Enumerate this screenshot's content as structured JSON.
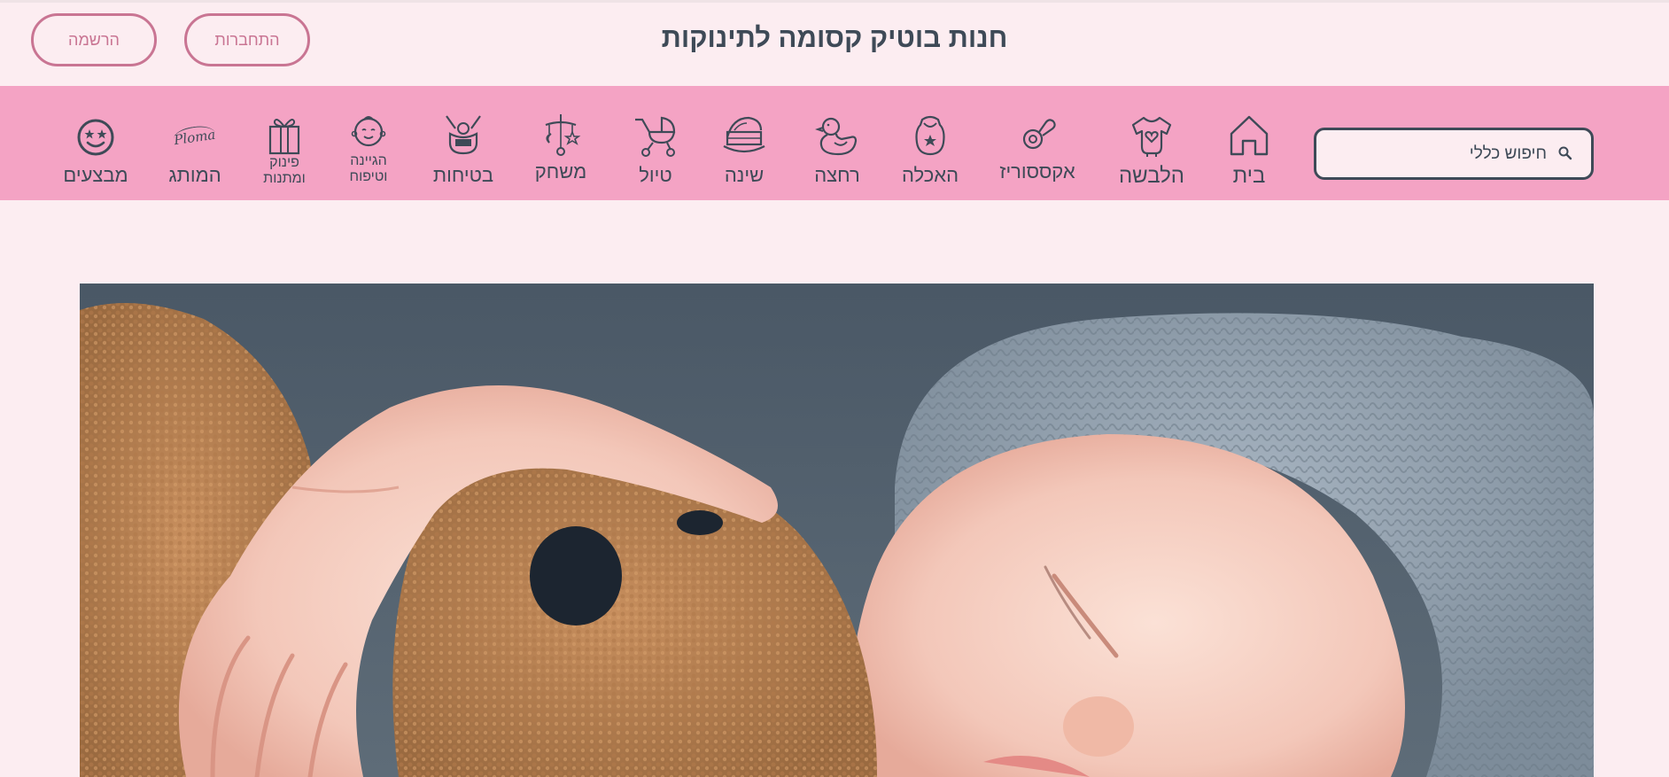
{
  "header": {
    "site_title": "חנות בוטיק קסומה לתינוקות",
    "register_label": "הרשמה",
    "login_label": "התחברות"
  },
  "search": {
    "placeholder": "חיפוש כללי",
    "icon": "search-icon"
  },
  "nav": {
    "items": [
      {
        "label": "בית",
        "icon": "home-icon"
      },
      {
        "label": "הלבשה",
        "icon": "onesie-icon"
      },
      {
        "label": "אקססוריז",
        "icon": "pacifier-icon"
      },
      {
        "label": "האכלה",
        "icon": "bib-icon"
      },
      {
        "label": "רחצה",
        "icon": "rubber-duck-icon"
      },
      {
        "label": "שינה",
        "icon": "cradle-icon"
      },
      {
        "label": "טיול",
        "icon": "stroller-icon"
      },
      {
        "label": "משחק",
        "icon": "mobile-toy-icon"
      },
      {
        "label": "בטיחות",
        "icon": "baby-carrier-icon"
      },
      {
        "label_line1": "הגיינה",
        "label_line2": "וטיפוח",
        "icon": "baby-face-icon"
      },
      {
        "label_line1": "פינוק",
        "label_line2": "ומתנות",
        "icon": "gift-icon"
      },
      {
        "label": "המותג",
        "icon": "ploma-logo-icon",
        "logo_text": "Ploma"
      },
      {
        "label": "מבצעים",
        "icon": "smiley-star-icon"
      }
    ]
  },
  "colors": {
    "background": "#fcedf1",
    "nav_background": "#f4a3c4",
    "accent": "#c97593",
    "text": "#3e4a57"
  },
  "hero": {
    "image": "sleeping-baby-with-teddy-bear"
  }
}
